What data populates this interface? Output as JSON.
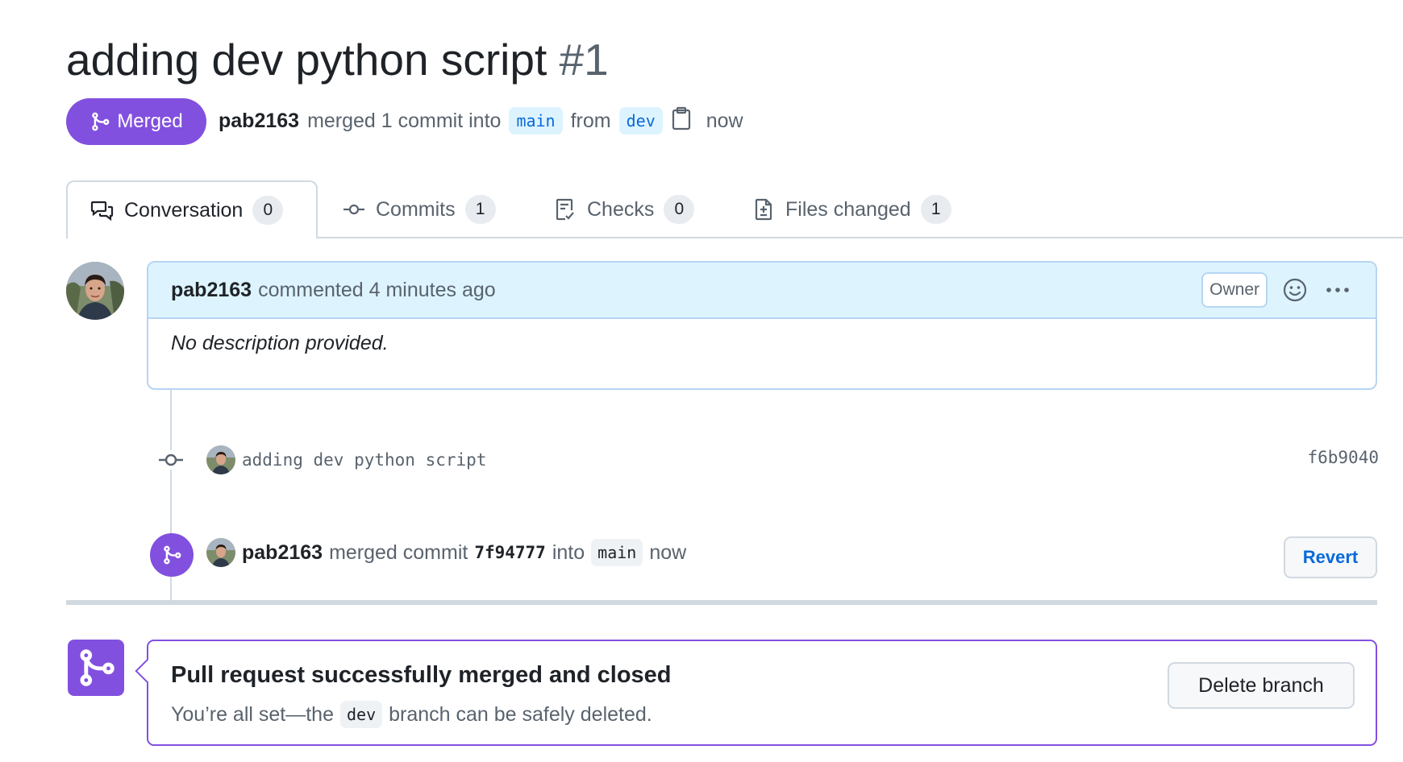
{
  "pr": {
    "title": "adding dev python script",
    "number": "#1",
    "status": "Merged",
    "author": "pab2163",
    "merge_text": "merged 1 commit into",
    "base_branch": "main",
    "from_text": "from",
    "head_branch": "dev",
    "time": "now"
  },
  "tabs": [
    {
      "label": "Conversation",
      "count": "0",
      "icon": "comment-discussion-icon",
      "active": true
    },
    {
      "label": "Commits",
      "count": "1",
      "icon": "git-commit-icon",
      "active": false
    },
    {
      "label": "Checks",
      "count": "0",
      "icon": "checklist-icon",
      "active": false
    },
    {
      "label": "Files changed",
      "count": "1",
      "icon": "file-diff-icon",
      "active": false
    }
  ],
  "comment": {
    "author": "pab2163",
    "action": "commented 4 minutes ago",
    "badge": "Owner",
    "body": "No description provided."
  },
  "commit": {
    "message": "adding dev python script",
    "sha": "f6b9040"
  },
  "merge_event": {
    "author": "pab2163",
    "text1": "merged commit",
    "sha": "7f94777",
    "text2": "into",
    "branch": "main",
    "time": "now",
    "revert_label": "Revert"
  },
  "merged_box": {
    "title": "Pull request successfully merged and closed",
    "sub_before": "You’re all set—the",
    "branch": "dev",
    "sub_after": "branch can be safely deleted.",
    "delete_label": "Delete branch"
  },
  "colors": {
    "merged_purple": "#8250df",
    "link_blue": "#0969da",
    "comment_header_bg": "#ddf4ff"
  }
}
